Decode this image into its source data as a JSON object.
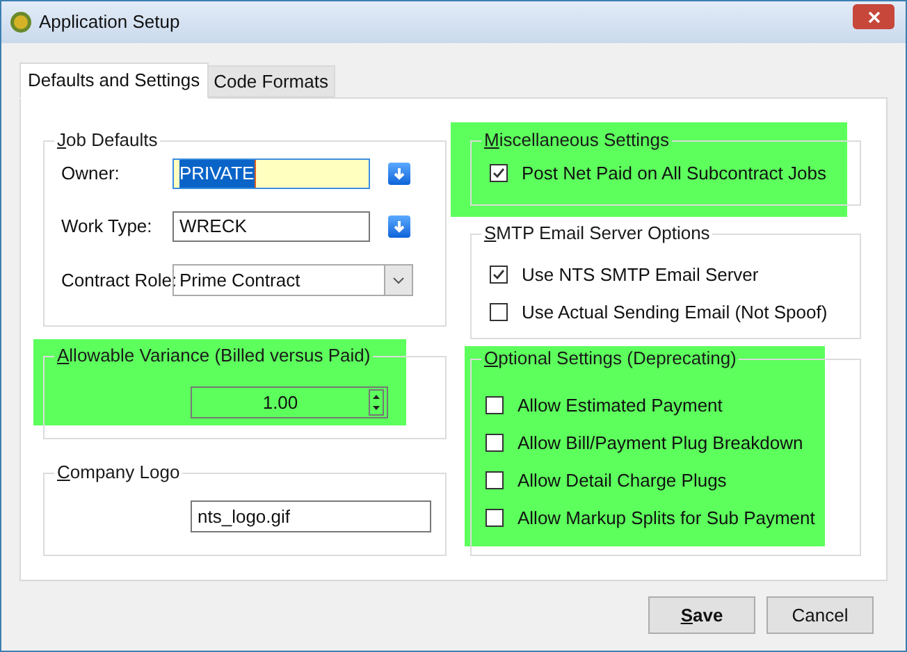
{
  "window": {
    "title": "Application Setup"
  },
  "tabs": [
    {
      "label": "Defaults and Settings",
      "selected": true
    },
    {
      "label": "Code Formats",
      "selected": false
    }
  ],
  "job_defaults": {
    "title": "Job Defaults",
    "highlighted": false,
    "fields": [
      {
        "label": "Owner:",
        "value": "PRIVATE",
        "kind": "lookup",
        "focused": true
      },
      {
        "label": "Work Type:",
        "value": "WRECK",
        "kind": "lookup",
        "focused": false
      },
      {
        "label": "Contract Role:",
        "value": "Prime Contract",
        "kind": "dropdown"
      }
    ]
  },
  "allowable_variance": {
    "title": "Allowable Variance (Billed versus Paid)",
    "highlighted": true,
    "value": "1.00"
  },
  "company_logo": {
    "title": "Company Logo",
    "highlighted": false,
    "value": "nts_logo.gif"
  },
  "miscellaneous_settings": {
    "title": "Miscellaneous Settings",
    "highlighted": true,
    "options": [
      {
        "label": "Post Net Paid on All Subcontract Jobs",
        "checked": true
      }
    ]
  },
  "smtp_email_server_options": {
    "title": "SMTP Email Server Options",
    "highlighted": false,
    "options": [
      {
        "label": "Use NTS SMTP Email Server",
        "checked": true
      },
      {
        "label": "Use Actual Sending Email (Not Spoof)",
        "checked": false
      }
    ]
  },
  "optional_settings": {
    "title": "Optional Settings (Deprecating)",
    "highlighted": true,
    "options": [
      {
        "label": "Allow Estimated Payment",
        "checked": false
      },
      {
        "label": "Allow Bill/Payment Plug Breakdown",
        "checked": false
      },
      {
        "label": "Allow Detail Charge Plugs",
        "checked": false
      },
      {
        "label": "Allow Markup Splits for Sub Payment",
        "checked": false
      }
    ]
  },
  "buttons": [
    {
      "label": "Save",
      "default": true
    },
    {
      "label": "Cancel",
      "default": false
    }
  ]
}
